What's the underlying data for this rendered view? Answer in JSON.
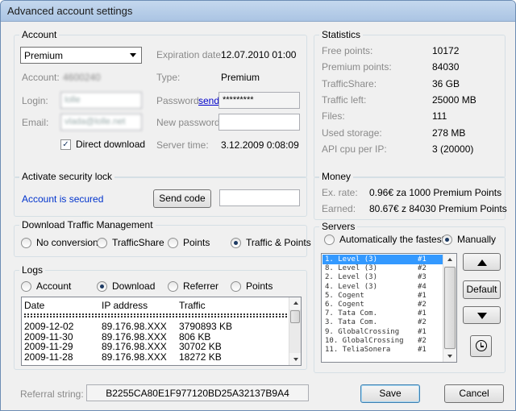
{
  "window": {
    "title": "Advanced account settings"
  },
  "account": {
    "group_title": "Account",
    "account_type_select": "Premium",
    "expiration_label": "Expiration date:",
    "expiration_value": "12.07.2010 01:00",
    "account_label": "Account:",
    "account_value": "4600240",
    "type_label": "Type:",
    "type_value": "Premium",
    "login_label": "Login:",
    "login_value": "lolle",
    "password_label": "Password:",
    "password_send_link": "send",
    "password_value": "*********",
    "email_label": "Email:",
    "email_value": "vlada@lolle.net",
    "new_password_label": "New password:",
    "new_password_value": "",
    "direct_download_label": "Direct download",
    "direct_download_checked": true,
    "server_time_label": "Server time:",
    "server_time_value": "3.12.2009 0:08:09"
  },
  "statistics": {
    "group_title": "Statistics",
    "rows": [
      {
        "label": "Free points:",
        "value": "10172"
      },
      {
        "label": "Premium points:",
        "value": "84030"
      },
      {
        "label": "TrafficShare:",
        "value": "36 GB"
      },
      {
        "label": "Traffic left:",
        "value": "25000 MB"
      },
      {
        "label": "Files:",
        "value": "111"
      },
      {
        "label": "Used storage:",
        "value": "278 MB"
      },
      {
        "label": "API cpu per IP:",
        "value": "3 (20000)"
      }
    ]
  },
  "security": {
    "group_title": "Activate security lock",
    "status": "Account is secured",
    "send_code_button": "Send code",
    "code_value": ""
  },
  "money": {
    "group_title": "Money",
    "exrate_label": "Ex. rate:",
    "exrate_value": "0.96€ za 1000 Premium Points",
    "earned_label": "Earned:",
    "earned_value": "80.67€ z 84030 Premium Points"
  },
  "traffic": {
    "group_title": "Download Traffic Management",
    "options": [
      "No conversion",
      "TrafficShare",
      "Points",
      "Traffic & Points"
    ],
    "selected": "Traffic & Points"
  },
  "servers": {
    "group_title": "Servers",
    "mode_options": [
      "Automatically the fastest",
      "Manually"
    ],
    "mode_selected": "Manually",
    "list": [
      {
        "name": "1. Level (3)",
        "num": "#1"
      },
      {
        "name": "8. Level (3)",
        "num": "#2"
      },
      {
        "name": "2. Level (3)",
        "num": "#3"
      },
      {
        "name": "4. Level (3)",
        "num": "#4"
      },
      {
        "name": "5. Cogent",
        "num": "#1"
      },
      {
        "name": "6. Cogent",
        "num": "#2"
      },
      {
        "name": "7. Tata Com.",
        "num": "#1"
      },
      {
        "name": "3. Tata Com.",
        "num": "#2"
      },
      {
        "name": "9. GlobalCrossing",
        "num": "#1"
      },
      {
        "name": "10. GlobalCrossing",
        "num": "#2"
      },
      {
        "name": "11. TeliaSonera",
        "num": "#1"
      }
    ],
    "selected_index": 0,
    "default_button": "Default"
  },
  "logs": {
    "group_title": "Logs",
    "tabs": [
      "Account",
      "Download",
      "Referrer",
      "Points"
    ],
    "selected_tab": "Download",
    "columns": [
      "Date",
      "IP address",
      "Traffic"
    ],
    "rows": [
      {
        "date": "2009-12-02",
        "ip": "89.176.98.XXX",
        "traffic": "3790893 KB"
      },
      {
        "date": "2009-11-30",
        "ip": "89.176.98.XXX",
        "traffic": "806 KB"
      },
      {
        "date": "2009-11-29",
        "ip": "89.176.98.XXX",
        "traffic": "30702 KB"
      },
      {
        "date": "2009-11-28",
        "ip": "89.176.98.XXX",
        "traffic": "18272 KB"
      }
    ]
  },
  "footer": {
    "referral_label": "Referral string:",
    "referral_value": "B2255CA80E1F977120BD25A32137B9A4",
    "save_button": "Save",
    "cancel_button": "Cancel"
  }
}
